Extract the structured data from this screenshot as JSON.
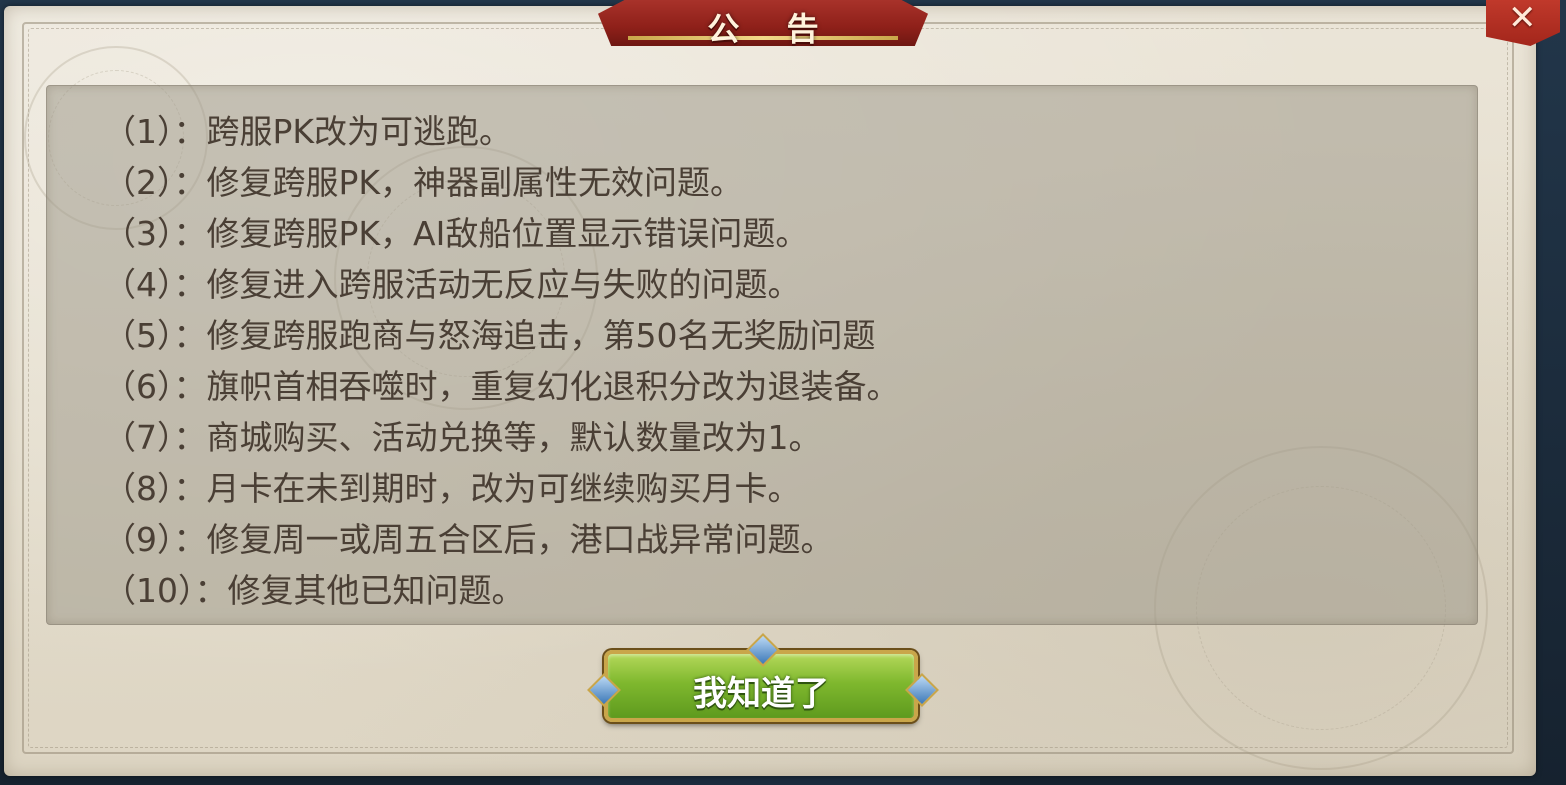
{
  "dialog": {
    "title": "公 告",
    "close_icon": "close-x-icon",
    "confirm_label": "我知道了"
  },
  "notices": [
    {
      "num": "（1）：",
      "text": "跨服PK改为可逃跑。"
    },
    {
      "num": "（2）：",
      "text": "修复跨服PK，神器副属性无效问题。"
    },
    {
      "num": "（3）：",
      "text": "修复跨服PK，AI敌船位置显示错误问题。"
    },
    {
      "num": "（4）：",
      "text": "修复进入跨服活动无反应与失败的问题。"
    },
    {
      "num": "（5）：",
      "text": "修复跨服跑商与怒海追击，第50名无奖励问题"
    },
    {
      "num": "（6）：",
      "text": "旗帜首相吞噬时，重复幻化退积分改为退装备。"
    },
    {
      "num": "（7）：",
      "text": "商城购买、活动兑换等，默认数量改为1。"
    },
    {
      "num": "（8）：",
      "text": "月卡在未到期时，改为可继续购买月卡。"
    },
    {
      "num": "（9）：",
      "text": "修复周一或周五合区后，港口战异常问题。"
    },
    {
      "num": "（10）：",
      "text": "修复其他已知问题。"
    }
  ],
  "colors": {
    "parchment": "#e4ddcc",
    "banner": "#a8322a",
    "text": "#4a3f35",
    "button": "#7fb82e"
  }
}
